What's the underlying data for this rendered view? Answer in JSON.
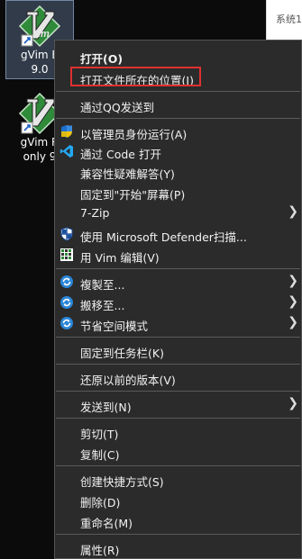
{
  "desktop": {
    "icon1": {
      "line1": "gVim E",
      "line2": "9.0"
    },
    "icon2": {
      "line1": "gVim R",
      "line2": "only 9"
    }
  },
  "background_window": {
    "text": "系统1"
  },
  "menu": {
    "items": [
      {
        "label": "打开(O)"
      },
      {
        "label": "打开文件所在的位置(I)"
      },
      {
        "label": "通过QQ发送到"
      },
      {
        "label": "以管理员身份运行(A)",
        "icon": "shield-icon"
      },
      {
        "label": "通过 Code 打开",
        "icon": "vscode-icon"
      },
      {
        "label": "兼容性疑难解答(Y)"
      },
      {
        "label": "固定到\"开始\"屏幕(P)"
      },
      {
        "label": "7-Zip"
      },
      {
        "label": "使用 Microsoft Defender扫描...",
        "icon": "defender-icon"
      },
      {
        "label": "用 Vim 编辑(V)",
        "icon": "vim-icon"
      },
      {
        "label": "複製至...",
        "icon": "sync-icon"
      },
      {
        "label": "搬移至...",
        "icon": "sync-icon"
      },
      {
        "label": "节省空间模式",
        "icon": "sync-icon"
      },
      {
        "label": "固定到任务栏(K)"
      },
      {
        "label": "还原以前的版本(V)"
      },
      {
        "label": "发送到(N)"
      },
      {
        "label": "剪切(T)"
      },
      {
        "label": "复制(C)"
      },
      {
        "label": "创建快捷方式(S)"
      },
      {
        "label": "删除(D)"
      },
      {
        "label": "重命名(M)"
      },
      {
        "label": "属性(R)"
      }
    ]
  },
  "colors": {
    "menu_bg": "#2b2b2b",
    "highlight": "#e03030",
    "shield_blue": "#1e6fd0",
    "vscode_blue": "#23a9f2"
  }
}
